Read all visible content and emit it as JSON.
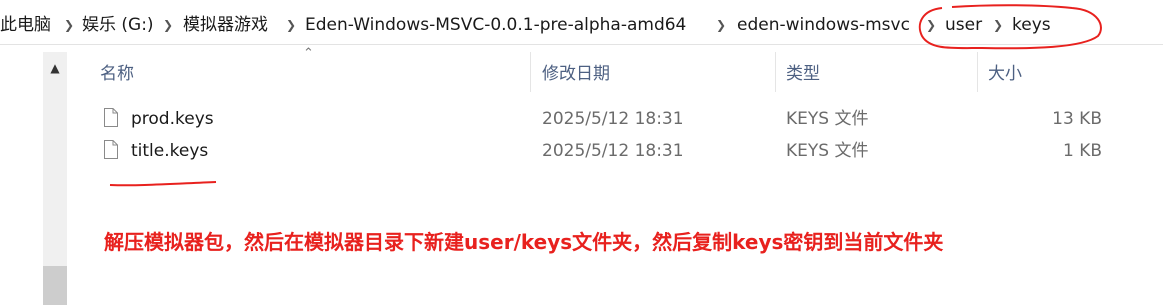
{
  "breadcrumb": {
    "items": [
      "此电脑",
      "娱乐 (G:)",
      "模拟器游戏",
      "Eden-Windows-MSVC-0.0.1-pre-alpha-amd64",
      "eden-windows-msvc",
      "user",
      "keys"
    ],
    "separator_icon": "chevron-right-icon"
  },
  "columns": {
    "name": "名称",
    "modified": "修改日期",
    "type": "类型",
    "size": "大小"
  },
  "files": [
    {
      "name": "prod.keys",
      "modified": "2025/5/12 18:31",
      "type": "KEYS 文件",
      "size": "13 KB"
    },
    {
      "name": "title.keys",
      "modified": "2025/5/12 18:31",
      "type": "KEYS 文件",
      "size": "1 KB"
    }
  ],
  "annotation": {
    "text": "解压模拟器包，然后在模拟器目录下新建user/keys文件夹，然后复制keys密钥到当前文件夹",
    "color": "#e8211e"
  },
  "colors": {
    "header_text": "#4d6082",
    "secondary_text": "#6b6b6b",
    "annotation_red": "#e8211e"
  }
}
